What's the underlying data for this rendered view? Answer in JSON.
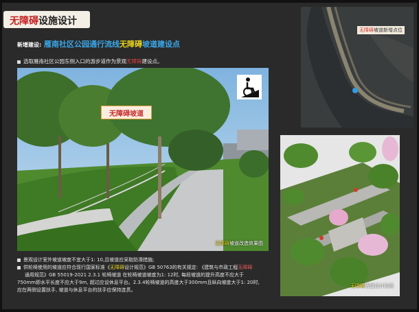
{
  "title": {
    "hl": "无障碍",
    "rest": "设施设计"
  },
  "subhead": {
    "label": "新增建设:",
    "part1": "雁南社区公园通行流线",
    "part2": "无障碍",
    "part3": "坡道建设点"
  },
  "intro": {
    "pre": "选取雁南社区公园东侧入口的游步道作为景观",
    "hl": "无障碍",
    "post": "建设点。"
  },
  "photo": {
    "sign_text": "无障碍坡道",
    "caption_hl": "无障碍",
    "caption_rest": "坡道改造效果图",
    "icon": "wheelchair-ramp-icon"
  },
  "map": {
    "label_hl": "无障碍",
    "label_rest": "坡道新增点位"
  },
  "iso": {
    "caption_hl": "无障碍",
    "caption_rest": "坡道设计标高"
  },
  "notes": {
    "line1": "景观设计室外坡道坡度不宜大于1: 10,且坡道应采取防滑措施;",
    "line2_a": "供轮椅使用的坡道应符合现行国家标准《",
    "line2_t": "无障碍",
    "line2_b": "设计规范》GB 50763的有关规定: 《建筑与市政工程",
    "line2_h": "无障碍",
    "line3": "通用规范》GB 55019-2021 2.3.1 轮椅坡道 在轮椅坡道坡度为1: 12时, 每段坡道的提升高度不应大于",
    "line4": "750mm即水平长度不应大于9m, 超过应设休息平台。2.3.4轮椅坡道的高度大于300mm且纵向坡度大于1: 20时,",
    "line5": "应在两侧设置扶手, 坡道与休息平台的扶手应保持连贯。"
  },
  "colors": {
    "accent_red": "#c51f1f",
    "accent_blue": "#3aa7e8",
    "accent_yellow": "#e8d31e",
    "background": "#2a2a2a"
  }
}
